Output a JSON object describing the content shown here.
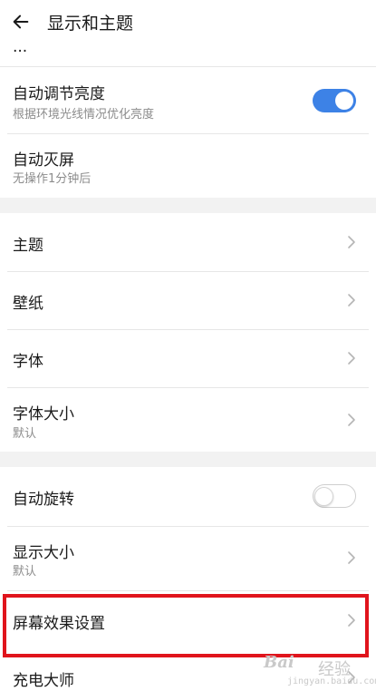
{
  "header": {
    "title": "显示和主题"
  },
  "peek_row": {
    "label": "...",
    "chevron_icon": "chevron-right-icon"
  },
  "sections": {
    "brightness": {
      "auto_brightness": {
        "label": "自动调节亮度",
        "subtitle": "根据环境光线情况优化亮度",
        "toggle": "on"
      },
      "auto_sleep": {
        "label": "自动灭屏",
        "subtitle": "无操作1分钟后"
      }
    },
    "appearance": {
      "theme": {
        "label": "主题"
      },
      "wallpaper": {
        "label": "壁纸"
      },
      "font": {
        "label": "字体"
      },
      "font_size": {
        "label": "字体大小",
        "subtitle": "默认"
      }
    },
    "display": {
      "auto_rotate": {
        "label": "自动旋转",
        "toggle": "off"
      },
      "display_size": {
        "label": "显示大小",
        "subtitle": "默认"
      },
      "screen_effects": {
        "label": "屏幕效果设置"
      },
      "charging_master": {
        "label": "充电大师"
      }
    }
  },
  "colors": {
    "toggle_on": "#3d82e6",
    "highlight_box": "#e0141c",
    "section_gap": "#f2f2f2"
  },
  "watermark": {
    "logo": "Bai",
    "text": "经验",
    "url": "jingyan.baidu.com"
  }
}
